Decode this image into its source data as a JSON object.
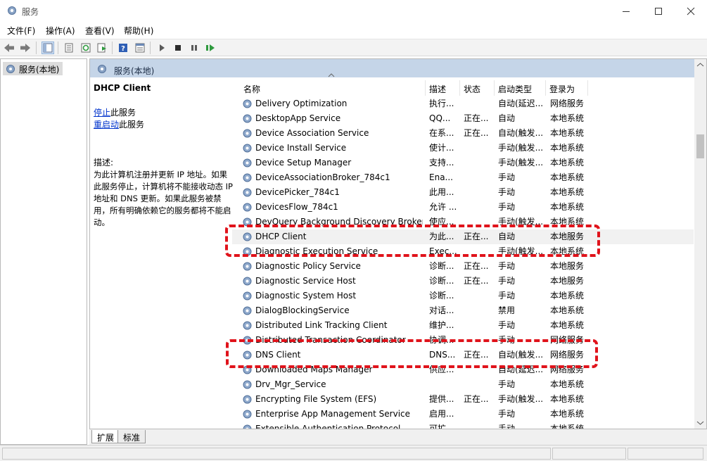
{
  "window": {
    "title": "服务",
    "app_icon": "gear-icon"
  },
  "menu": [
    "文件(F)",
    "操作(A)",
    "查看(V)",
    "帮助(H)"
  ],
  "left_tree": {
    "selected_label": "服务(本地)"
  },
  "panel": {
    "header": "服务(本地)"
  },
  "details": {
    "service_name": "DHCP Client",
    "action_stop_link": "停止",
    "action_stop_rest": "此服务",
    "action_restart_link": "重启动",
    "action_restart_rest": "此服务",
    "desc_label": "描述:",
    "desc_text": "为此计算机注册并更新 IP 地址。如果此服务停止，计算机将不能接收动态 IP 地址和 DNS 更新。如果此服务被禁用，所有明确依赖它的服务都将不能启动。"
  },
  "columns": {
    "name": "名称",
    "desc": "描述",
    "status": "状态",
    "startup": "启动类型",
    "logon": "登录为"
  },
  "services": [
    {
      "name": "Delivery Optimization",
      "desc": "执行...",
      "status": "",
      "startup": "自动(延迟...",
      "logon": "网络服务"
    },
    {
      "name": "DesktopApp Service",
      "desc": "QQ...",
      "status": "正在...",
      "startup": "自动",
      "logon": "本地系统"
    },
    {
      "name": "Device Association Service",
      "desc": "在系...",
      "status": "正在...",
      "startup": "自动(触发...",
      "logon": "本地系统"
    },
    {
      "name": "Device Install Service",
      "desc": "使计...",
      "status": "",
      "startup": "手动(触发...",
      "logon": "本地系统"
    },
    {
      "name": "Device Setup Manager",
      "desc": "支持...",
      "status": "",
      "startup": "手动(触发...",
      "logon": "本地系统"
    },
    {
      "name": "DeviceAssociationBroker_784c1",
      "desc": "Ena...",
      "status": "",
      "startup": "手动",
      "logon": "本地系统"
    },
    {
      "name": "DevicePicker_784c1",
      "desc": "此用...",
      "status": "",
      "startup": "手动",
      "logon": "本地系统"
    },
    {
      "name": "DevicesFlow_784c1",
      "desc": "允许 ...",
      "status": "",
      "startup": "手动",
      "logon": "本地系统"
    },
    {
      "name": "DevQuery Background Discovery Broker",
      "desc": "使应...",
      "status": "",
      "startup": "手动(触发...",
      "logon": "本地系统"
    },
    {
      "name": "DHCP Client",
      "desc": "为此...",
      "status": "正在...",
      "startup": "自动",
      "logon": "本地服务"
    },
    {
      "name": "Diagnostic Execution Service",
      "desc": "Exec...",
      "status": "",
      "startup": "手动(触发...",
      "logon": "本地系统"
    },
    {
      "name": "Diagnostic Policy Service",
      "desc": "诊断...",
      "status": "正在...",
      "startup": "手动",
      "logon": "本地服务"
    },
    {
      "name": "Diagnostic Service Host",
      "desc": "诊断...",
      "status": "正在...",
      "startup": "手动",
      "logon": "本地服务"
    },
    {
      "name": "Diagnostic System Host",
      "desc": "诊断...",
      "status": "",
      "startup": "手动",
      "logon": "本地系统"
    },
    {
      "name": "DialogBlockingService",
      "desc": "对话...",
      "status": "",
      "startup": "禁用",
      "logon": "本地系统"
    },
    {
      "name": "Distributed Link Tracking Client",
      "desc": "维护...",
      "status": "",
      "startup": "手动",
      "logon": "本地系统"
    },
    {
      "name": "Distributed Transaction Coordinator",
      "desc": "协调...",
      "status": "",
      "startup": "手动",
      "logon": "网络服务"
    },
    {
      "name": "DNS Client",
      "desc": "DNS...",
      "status": "正在...",
      "startup": "自动(触发...",
      "logon": "网络服务"
    },
    {
      "name": "Downloaded Maps Manager",
      "desc": "供应...",
      "status": "",
      "startup": "自动(延迟...",
      "logon": "网络服务"
    },
    {
      "name": "Drv_Mgr_Service",
      "desc": "",
      "status": "",
      "startup": "手动",
      "logon": "本地系统"
    },
    {
      "name": "Encrypting File System (EFS)",
      "desc": "提供...",
      "status": "正在...",
      "startup": "手动(触发...",
      "logon": "本地系统"
    },
    {
      "name": "Enterprise App Management Service",
      "desc": "启用...",
      "status": "",
      "startup": "手动",
      "logon": "本地系统"
    },
    {
      "name": "Extensible Authentication Protocol",
      "desc": "可扩...",
      "status": "",
      "startup": "手动",
      "logon": "本地系统"
    }
  ],
  "selected_service": "DHCP Client",
  "tabs": [
    "扩展",
    "标准"
  ],
  "colors": {
    "header_bg": "#c5d5e8",
    "highlight_red": "#e0131b",
    "link_blue": "#0033cc"
  }
}
